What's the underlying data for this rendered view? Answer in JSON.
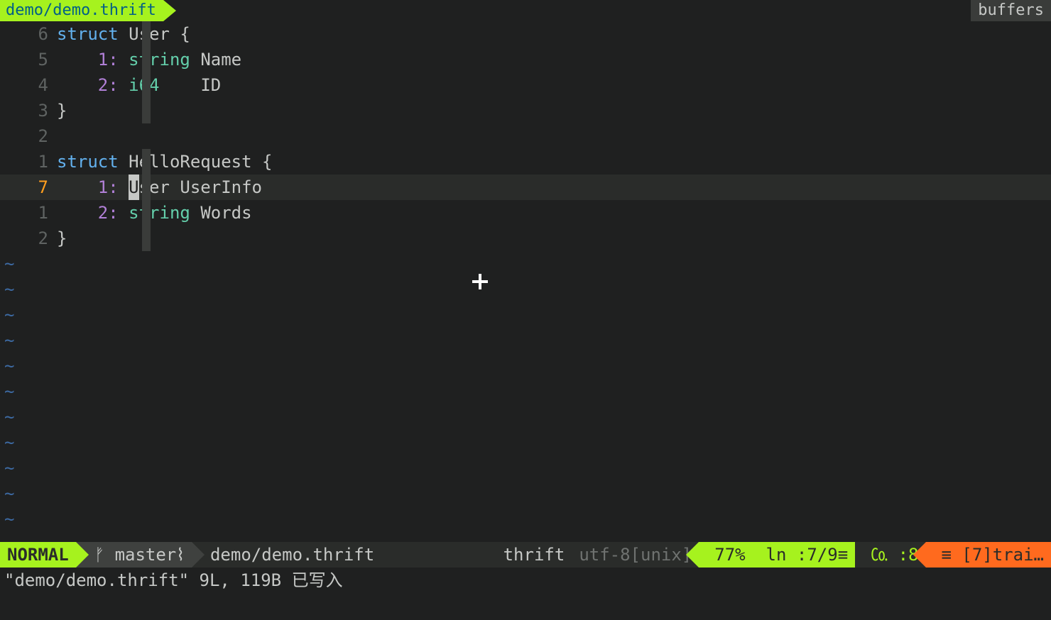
{
  "tab": {
    "title": "demo/demo.thrift"
  },
  "buffers_label": "buffers",
  "gutter": [
    "6",
    "5",
    "4",
    "3",
    "2",
    "1",
    "7",
    "1",
    "2"
  ],
  "current_line_index": 6,
  "code": {
    "l0": {
      "kw": "struct",
      "name": " User {"
    },
    "l1": {
      "pad": "    ",
      "idx": "1:",
      "sp1": " ",
      "type": "string",
      "sp2": " ",
      "ident": "Name"
    },
    "l2": {
      "pad": "    ",
      "idx": "2:",
      "sp1": " ",
      "type": "i64",
      "sp2": "    ",
      "ident": "ID"
    },
    "l3": {
      "txt": "}"
    },
    "l4": {
      "txt": ""
    },
    "l5": {
      "kw": "struct",
      "name": " HelloRequest {"
    },
    "l6": {
      "pad": "    ",
      "idx": "1:",
      "sp1": " ",
      "cur": "U",
      "rest": "ser UserInfo"
    },
    "l7": {
      "pad": "    ",
      "idx": "2:",
      "sp1": " ",
      "type": "string",
      "sp2": " ",
      "ident": "Words"
    },
    "l8": {
      "txt": "}"
    }
  },
  "status": {
    "mode": "NORMAL",
    "branch_icon": "ᚠ",
    "branch": "master",
    "branch_dirty_icon": "⌇",
    "filename": "demo/demo.thrift",
    "filetype": "thrift",
    "encoding": "utf-8[unix]",
    "percent": "77%",
    "line_label": "ln :",
    "line": "7/9",
    "line_icon": "≡",
    "col_icon": "㏇",
    "col_prefix": " :",
    "col": "8",
    "trailing_icon": "≡",
    "trailing": "[7]trai…"
  },
  "cmdline": "\"demo/demo.thrift\" 9L, 119B 已写入"
}
